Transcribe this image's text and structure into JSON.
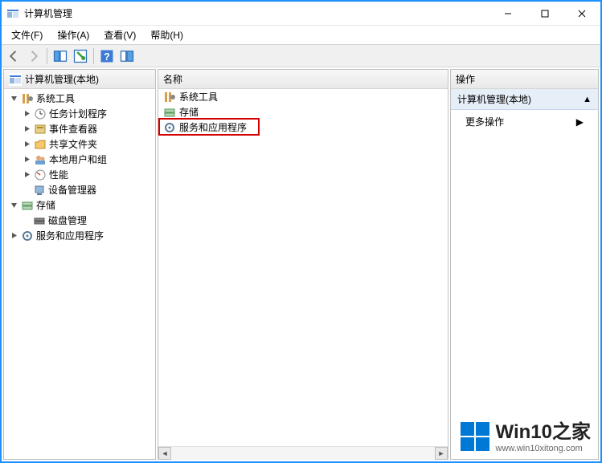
{
  "window": {
    "title": "计算机管理"
  },
  "menu": {
    "file": "文件(F)",
    "action": "操作(A)",
    "view": "查看(V)",
    "help": "帮助(H)"
  },
  "tree": {
    "root": "计算机管理(本地)",
    "items": [
      {
        "label": "系统工具",
        "children": [
          {
            "label": "任务计划程序"
          },
          {
            "label": "事件查看器"
          },
          {
            "label": "共享文件夹"
          },
          {
            "label": "本地用户和组"
          },
          {
            "label": "性能"
          },
          {
            "label": "设备管理器"
          }
        ]
      },
      {
        "label": "存储",
        "children": [
          {
            "label": "磁盘管理"
          }
        ]
      },
      {
        "label": "服务和应用程序"
      }
    ]
  },
  "list": {
    "header": "名称",
    "items": [
      {
        "label": "系统工具"
      },
      {
        "label": "存储"
      },
      {
        "label": "服务和应用程序"
      }
    ]
  },
  "actions": {
    "header": "操作",
    "context": "计算机管理(本地)",
    "more": "更多操作"
  },
  "watermark": {
    "line1": "Win10之家",
    "line2": "www.win10xitong.com"
  }
}
